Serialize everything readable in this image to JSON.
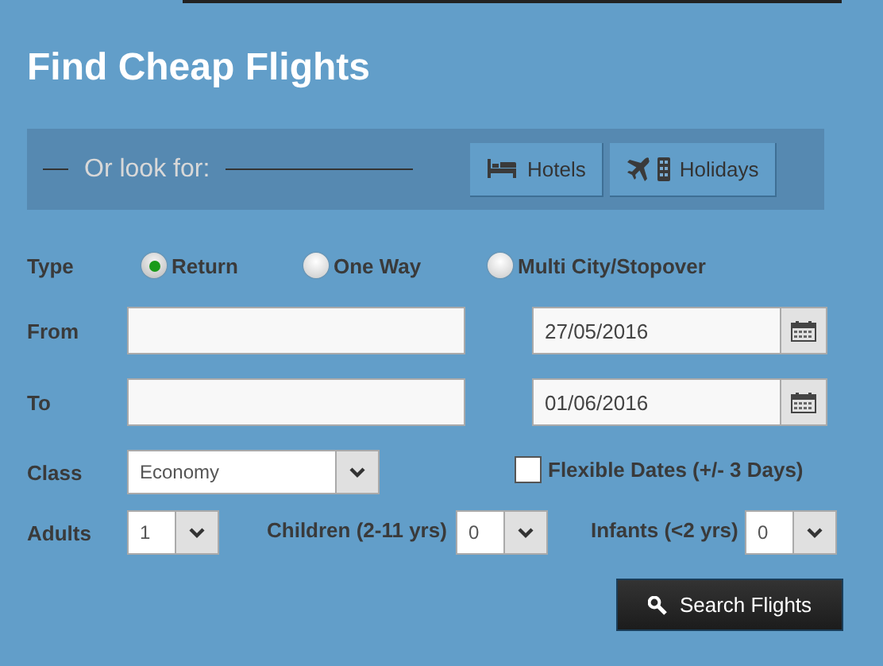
{
  "title": "Find Cheap Flights",
  "look_for": {
    "label": "Or look for:",
    "buttons": [
      {
        "kind": "hotels",
        "label": "Hotels"
      },
      {
        "kind": "holidays",
        "label": "Holidays"
      }
    ]
  },
  "type": {
    "label": "Type",
    "options": [
      {
        "label": "Return",
        "selected": true
      },
      {
        "label": "One Way",
        "selected": false
      },
      {
        "label": "Multi City/Stopover",
        "selected": false
      }
    ]
  },
  "from": {
    "label": "From",
    "date": "27/05/2016"
  },
  "to": {
    "label": "To",
    "date": "01/06/2016"
  },
  "class": {
    "label": "Class",
    "value": "Economy"
  },
  "flexible_dates": {
    "label": "Flexible Dates (+/- 3 Days)",
    "checked": false
  },
  "passengers": [
    {
      "label": "Adults",
      "value": "1"
    },
    {
      "label": "Children (2-11 yrs)",
      "value": "0"
    },
    {
      "label": "Infants (<2 yrs)",
      "value": "0"
    }
  ],
  "search_button": "Search Flights"
}
